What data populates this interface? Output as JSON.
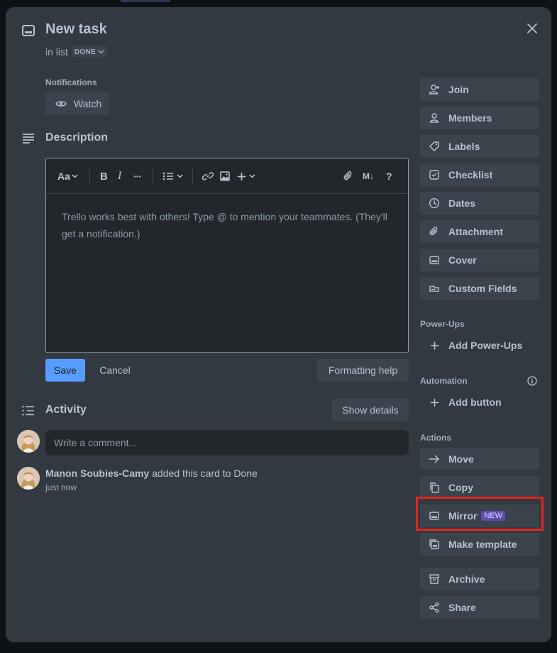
{
  "card": {
    "title": "New task",
    "in_list_prefix": "in list",
    "list_name": "DONE"
  },
  "notifications": {
    "label": "Notifications",
    "watch_label": "Watch"
  },
  "description": {
    "heading": "Description",
    "toolbar": {
      "text_style": "Aa",
      "bold": "B",
      "italic": "I",
      "more": "···",
      "markdown": "M↓",
      "help": "?"
    },
    "placeholder": "Trello works best with others! Type @ to mention your teammates. (They'll get a notification.)",
    "save_label": "Save",
    "cancel_label": "Cancel",
    "formatting_help_label": "Formatting help"
  },
  "activity": {
    "heading": "Activity",
    "show_details_label": "Show details",
    "comment_placeholder": "Write a comment...",
    "entries": [
      {
        "user": "Manon Soubies-Camy",
        "action": " added this card to Done",
        "time": "just now"
      }
    ]
  },
  "sidebar": {
    "card_actions": [
      {
        "label": "Join",
        "icon": "add-person-icon"
      },
      {
        "label": "Members",
        "icon": "person-icon"
      },
      {
        "label": "Labels",
        "icon": "tag-icon"
      },
      {
        "label": "Checklist",
        "icon": "checkbox-icon"
      },
      {
        "label": "Dates",
        "icon": "clock-icon"
      },
      {
        "label": "Attachment",
        "icon": "paperclip-icon"
      },
      {
        "label": "Cover",
        "icon": "card-cover-icon"
      },
      {
        "label": "Custom Fields",
        "icon": "custom-field-icon"
      }
    ],
    "power_ups": {
      "label": "Power-Ups",
      "add_label": "Add Power-Ups"
    },
    "automation": {
      "label": "Automation",
      "add_label": "Add button"
    },
    "actions": {
      "label": "Actions",
      "items": [
        {
          "label": "Move",
          "icon": "arrow-right-icon"
        },
        {
          "label": "Copy",
          "icon": "copy-icon"
        },
        {
          "label": "Mirror",
          "icon": "mirror-icon",
          "badge": "NEW"
        },
        {
          "label": "Make template",
          "icon": "template-icon"
        }
      ],
      "secondary": [
        {
          "label": "Archive",
          "icon": "archive-icon"
        },
        {
          "label": "Share",
          "icon": "share-icon"
        }
      ]
    }
  },
  "colors": {
    "modal_bg": "#323940",
    "button_bg": "#3b444c",
    "primary": "#579dff",
    "highlight_box": "#e5251f",
    "new_badge": "#5e4db2"
  }
}
